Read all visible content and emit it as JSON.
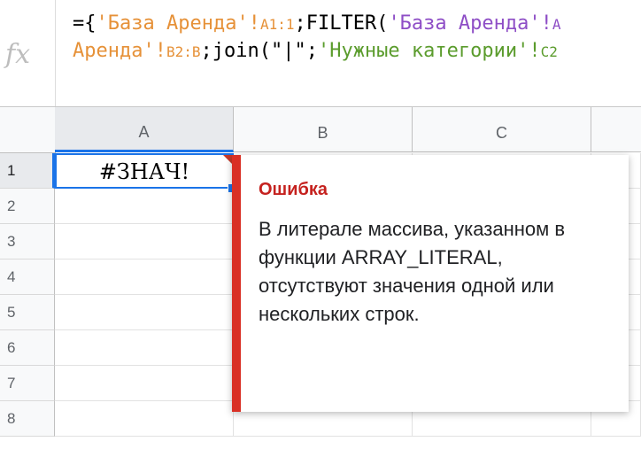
{
  "formula_bar": {
    "fx_label": "fx",
    "line1": [
      {
        "text": "={",
        "color": "black"
      },
      {
        "text": "'База Аренда'!",
        "color": "orange"
      },
      {
        "text": "A1:1",
        "color": "orange",
        "small": true
      },
      {
        "text": ";FILTER(",
        "color": "black"
      },
      {
        "text": "'База Аренда'!",
        "color": "purple"
      },
      {
        "text": "A",
        "color": "purple",
        "small": true
      }
    ],
    "line2": [
      {
        "text": "Аренда'!",
        "color": "orange"
      },
      {
        "text": "B2:B",
        "color": "orange",
        "small": true
      },
      {
        "text": ";join(\"|\";",
        "color": "black"
      },
      {
        "text": "'Нужные категории'!",
        "color": "green"
      },
      {
        "text": "C2",
        "color": "green",
        "small": true
      }
    ]
  },
  "columns": [
    "A",
    "B",
    "C"
  ],
  "rows": [
    "1",
    "2",
    "3",
    "4",
    "5",
    "6",
    "7",
    "8"
  ],
  "active_cell": {
    "ref": "A1",
    "value": "#ЗНАЧ!"
  },
  "error_popup": {
    "title": "Ошибка",
    "message": "В литерале массива, указанном в функции ARRAY_LITERAL, отсутствуют значения одной или нескольких строк.",
    "accent_color": "#d93025"
  },
  "colors": {
    "selection": "#1a73e8",
    "header_bg": "#f8f9fa",
    "orange": "#e69138",
    "purple": "#8e4ec6",
    "green": "#5b9c2d"
  }
}
